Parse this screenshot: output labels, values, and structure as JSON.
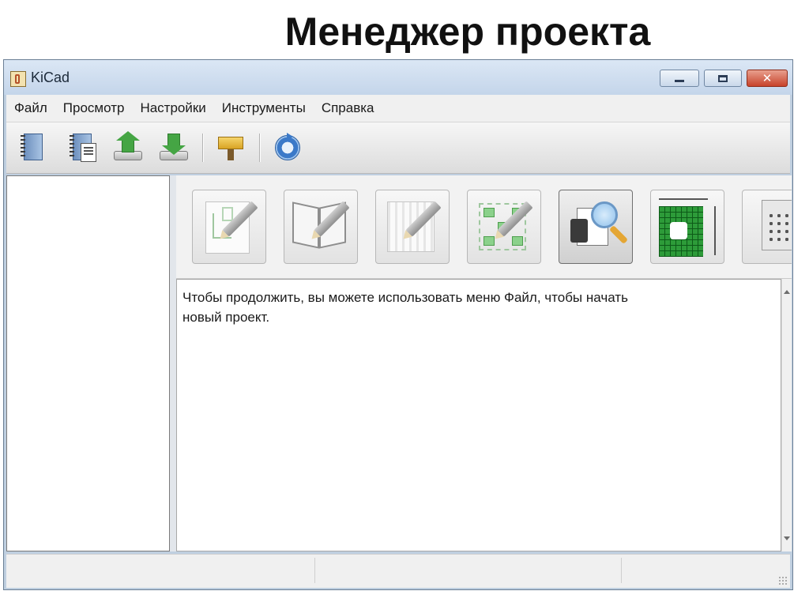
{
  "slide": {
    "title": "Менеджер проекта"
  },
  "window": {
    "title": "KiCad",
    "app_icon": "kicad-app-icon",
    "controls": [
      "minimize-icon",
      "maximize-icon",
      "close-icon"
    ]
  },
  "menu": {
    "items": [
      {
        "label": "Файл"
      },
      {
        "label": "Просмотр"
      },
      {
        "label": "Настройки"
      },
      {
        "label": "Инструменты"
      },
      {
        "label": "Справка"
      }
    ]
  },
  "toolbar": {
    "buttons": [
      {
        "icon": "new-project-icon"
      },
      {
        "icon": "new-project-from-template-icon"
      },
      {
        "icon": "open-project-upload-icon"
      },
      {
        "icon": "save-project-download-icon"
      },
      {
        "icon": "archive-brush-icon"
      },
      {
        "icon": "refresh-icon"
      }
    ]
  },
  "launcher": {
    "buttons": [
      {
        "icon": "schematic-editor-icon"
      },
      {
        "icon": "library-editor-icon"
      },
      {
        "icon": "pcb-editor-icon"
      },
      {
        "icon": "footprint-editor-icon"
      },
      {
        "icon": "gerber-viewer-icon"
      },
      {
        "icon": "bitmap-converter-icon"
      },
      {
        "icon": "calculator-icon"
      }
    ]
  },
  "message": {
    "text": "Чтобы продолжить, вы можете использовать меню Файл, чтобы начать\nновый проект."
  },
  "statusbar": {
    "cells": [
      "",
      "",
      ""
    ]
  }
}
